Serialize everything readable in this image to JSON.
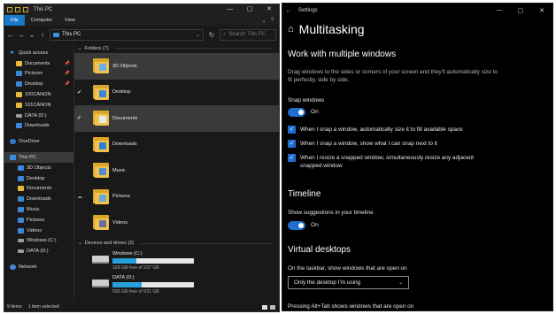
{
  "explorer": {
    "title": "This PC",
    "window_controls": [
      "—",
      "▢",
      "✕"
    ],
    "ribbon_tabs": [
      "File",
      "Computer",
      "View"
    ],
    "address": "This PC",
    "search_placeholder": "Search This PC",
    "nav": [
      {
        "label": "Quick access",
        "icon": "star-icon",
        "level": 0,
        "pinned": false
      },
      {
        "label": "Documents",
        "icon": "documents-icon",
        "level": 1,
        "pinned": true
      },
      {
        "label": "Pictures",
        "icon": "pictures-icon",
        "level": 1,
        "pinned": true
      },
      {
        "label": "Desktop",
        "icon": "desktop-icon",
        "level": 1,
        "pinned": true
      },
      {
        "label": "100CANON",
        "icon": "folder-icon",
        "level": 1,
        "pinned": false
      },
      {
        "label": "101CANON",
        "icon": "folder-icon",
        "level": 1,
        "pinned": false
      },
      {
        "label": "DATA (D:)",
        "icon": "drive-icon",
        "level": 1,
        "pinned": false
      },
      {
        "label": "Downloads",
        "icon": "downloads-icon",
        "level": 1,
        "pinned": false
      },
      {
        "label": "OneDrive",
        "icon": "cloud-icon",
        "level": 0,
        "pinned": false
      },
      {
        "label": "This PC",
        "icon": "pc-icon",
        "level": 0,
        "pinned": false,
        "selected": true
      },
      {
        "label": "3D Objects",
        "icon": "3d-objects-icon",
        "level": 2,
        "pinned": false
      },
      {
        "label": "Desktop",
        "icon": "desktop-icon",
        "level": 2,
        "pinned": false
      },
      {
        "label": "Documents",
        "icon": "documents-icon",
        "level": 2,
        "pinned": false
      },
      {
        "label": "Downloads",
        "icon": "downloads-icon",
        "level": 2,
        "pinned": false
      },
      {
        "label": "Music",
        "icon": "music-icon",
        "level": 2,
        "pinned": false
      },
      {
        "label": "Pictures",
        "icon": "pictures-icon",
        "level": 2,
        "pinned": false
      },
      {
        "label": "Videos",
        "icon": "videos-icon",
        "level": 2,
        "pinned": false
      },
      {
        "label": "Windows (C:)",
        "icon": "drive-icon",
        "level": 2,
        "pinned": false
      },
      {
        "label": "DATA (D:)",
        "icon": "drive-icon",
        "level": 2,
        "pinned": false
      },
      {
        "label": "Network",
        "icon": "network-icon",
        "level": 0,
        "pinned": false
      }
    ],
    "folders_group": "Folders (7)",
    "folders": [
      {
        "name": "3D Objects",
        "status": "",
        "selected": true,
        "glyph_color": "#6ab0e8"
      },
      {
        "name": "Desktop",
        "status": "synced",
        "selected": false,
        "glyph_color": "#3d87d6"
      },
      {
        "name": "Documents",
        "status": "synced",
        "selected": true,
        "glyph_color": "#e9e9e9"
      },
      {
        "name": "Downloads",
        "status": "",
        "selected": false,
        "glyph_color": "#2e7fd4"
      },
      {
        "name": "Music",
        "status": "",
        "selected": false,
        "glyph_color": "#4d8fd1"
      },
      {
        "name": "Pictures",
        "status": "cloud",
        "selected": false,
        "glyph_color": "#6fa9d8"
      },
      {
        "name": "Videos",
        "status": "",
        "selected": false,
        "glyph_color": "#6c6c9a"
      }
    ],
    "drives_group": "Devices and drives (2)",
    "drives": [
      {
        "name": "Windows (C:)",
        "free": "169 GB free of 237 GB",
        "used_fraction": 0.29
      },
      {
        "name": "DATA (D:)",
        "free": "595 GB free of 931 GB",
        "used_fraction": 0.36
      }
    ],
    "status": {
      "items": "9 items",
      "selected": "1 item selected"
    }
  },
  "settings": {
    "window_title": "Settings",
    "window_controls": [
      "—",
      "▢",
      "✕"
    ],
    "page_title": "Multitasking",
    "accent": "#1f6fd0",
    "section_windows": "Work with multiple windows",
    "windows_desc": "Drag windows to the sides or corners of your screen and they'll automatically size to fit perfectly, side by side.",
    "snap_label": "Snap windows",
    "snap_state": "On",
    "checks": [
      {
        "label": "When I snap a window, automatically size it to fill available space",
        "checked": true
      },
      {
        "label": "When I snap a window, show what I can snap next to it",
        "checked": true
      },
      {
        "label": "When I resize a snapped window, simultaneously resize any adjacent snapped window",
        "checked": true
      }
    ],
    "section_timeline": "Timeline",
    "timeline_label": "Show suggestions in your timeline",
    "timeline_state": "On",
    "section_desktops": "Virtual desktops",
    "taskbar_label": "On the taskbar, show windows that are open on",
    "taskbar_value": "Only the desktop I'm using",
    "alttab_label": "Pressing Alt+Tab shows windows that are open on"
  }
}
